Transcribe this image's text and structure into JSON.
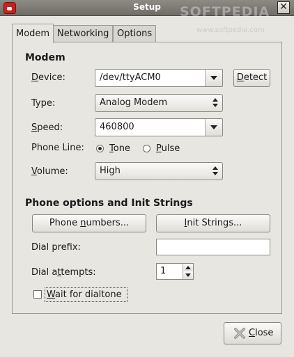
{
  "window": {
    "title": "Setup",
    "watermark": "SOFTPEDIA",
    "watermark_url": "www.softpedia.com"
  },
  "tabs": [
    {
      "label": "Modem",
      "active": true
    },
    {
      "label": "Networking",
      "active": false
    },
    {
      "label": "Options",
      "active": false
    }
  ],
  "modem": {
    "section_title": "Modem",
    "device": {
      "label_u": "D",
      "label_rest": "evice:",
      "value": "/dev/ttyACM0",
      "detect_u": "D",
      "detect_rest": "etect"
    },
    "type": {
      "label": "Type:",
      "value": "Analog Modem"
    },
    "speed": {
      "label_u": "S",
      "label_rest": "peed:",
      "value": "460800"
    },
    "phone_line": {
      "label": "Phone Line:",
      "tone_u": "T",
      "tone_rest": "one",
      "pulse_u": "P",
      "pulse_rest": "ulse",
      "selected": "Tone"
    },
    "volume": {
      "label_u": "V",
      "label_rest": "olume:",
      "value": "High"
    }
  },
  "phone_options": {
    "section_title": "Phone options and Init Strings",
    "phone_numbers_pre": "Phone ",
    "phone_numbers_u": "n",
    "phone_numbers_post": "umbers...",
    "init_strings_u": "I",
    "init_strings_rest": "nit Strings...",
    "dial_prefix": {
      "label": "Dial prefix:",
      "value": ""
    },
    "dial_attempts": {
      "label_pre": "Dial a",
      "label_u": "t",
      "label_post": "tempts:",
      "value": "1"
    },
    "wait_dialtone": {
      "label_u": "W",
      "label_rest": "ait for dialtone",
      "checked": false
    }
  },
  "footer": {
    "close_u": "C",
    "close_rest": "lose"
  },
  "colors": {
    "close_icon": "#9a9995",
    "app_icon": "#c4231d"
  }
}
